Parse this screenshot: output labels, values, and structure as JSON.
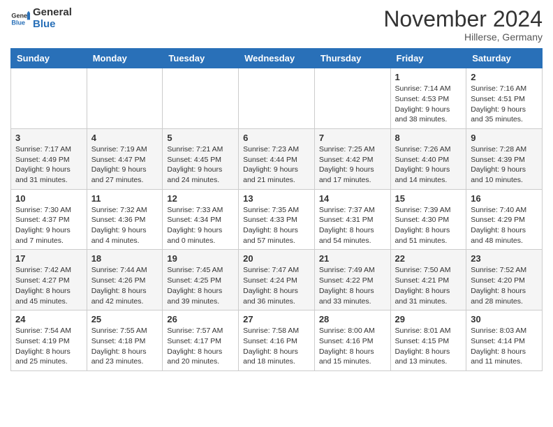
{
  "header": {
    "logo_general": "General",
    "logo_blue": "Blue",
    "title": "November 2024",
    "subtitle": "Hillerse, Germany"
  },
  "weekdays": [
    "Sunday",
    "Monday",
    "Tuesday",
    "Wednesday",
    "Thursday",
    "Friday",
    "Saturday"
  ],
  "weeks": [
    [
      {
        "day": "",
        "info": ""
      },
      {
        "day": "",
        "info": ""
      },
      {
        "day": "",
        "info": ""
      },
      {
        "day": "",
        "info": ""
      },
      {
        "day": "",
        "info": ""
      },
      {
        "day": "1",
        "info": "Sunrise: 7:14 AM\nSunset: 4:53 PM\nDaylight: 9 hours\nand 38 minutes."
      },
      {
        "day": "2",
        "info": "Sunrise: 7:16 AM\nSunset: 4:51 PM\nDaylight: 9 hours\nand 35 minutes."
      }
    ],
    [
      {
        "day": "3",
        "info": "Sunrise: 7:17 AM\nSunset: 4:49 PM\nDaylight: 9 hours\nand 31 minutes."
      },
      {
        "day": "4",
        "info": "Sunrise: 7:19 AM\nSunset: 4:47 PM\nDaylight: 9 hours\nand 27 minutes."
      },
      {
        "day": "5",
        "info": "Sunrise: 7:21 AM\nSunset: 4:45 PM\nDaylight: 9 hours\nand 24 minutes."
      },
      {
        "day": "6",
        "info": "Sunrise: 7:23 AM\nSunset: 4:44 PM\nDaylight: 9 hours\nand 21 minutes."
      },
      {
        "day": "7",
        "info": "Sunrise: 7:25 AM\nSunset: 4:42 PM\nDaylight: 9 hours\nand 17 minutes."
      },
      {
        "day": "8",
        "info": "Sunrise: 7:26 AM\nSunset: 4:40 PM\nDaylight: 9 hours\nand 14 minutes."
      },
      {
        "day": "9",
        "info": "Sunrise: 7:28 AM\nSunset: 4:39 PM\nDaylight: 9 hours\nand 10 minutes."
      }
    ],
    [
      {
        "day": "10",
        "info": "Sunrise: 7:30 AM\nSunset: 4:37 PM\nDaylight: 9 hours\nand 7 minutes."
      },
      {
        "day": "11",
        "info": "Sunrise: 7:32 AM\nSunset: 4:36 PM\nDaylight: 9 hours\nand 4 minutes."
      },
      {
        "day": "12",
        "info": "Sunrise: 7:33 AM\nSunset: 4:34 PM\nDaylight: 9 hours\nand 0 minutes."
      },
      {
        "day": "13",
        "info": "Sunrise: 7:35 AM\nSunset: 4:33 PM\nDaylight: 8 hours\nand 57 minutes."
      },
      {
        "day": "14",
        "info": "Sunrise: 7:37 AM\nSunset: 4:31 PM\nDaylight: 8 hours\nand 54 minutes."
      },
      {
        "day": "15",
        "info": "Sunrise: 7:39 AM\nSunset: 4:30 PM\nDaylight: 8 hours\nand 51 minutes."
      },
      {
        "day": "16",
        "info": "Sunrise: 7:40 AM\nSunset: 4:29 PM\nDaylight: 8 hours\nand 48 minutes."
      }
    ],
    [
      {
        "day": "17",
        "info": "Sunrise: 7:42 AM\nSunset: 4:27 PM\nDaylight: 8 hours\nand 45 minutes."
      },
      {
        "day": "18",
        "info": "Sunrise: 7:44 AM\nSunset: 4:26 PM\nDaylight: 8 hours\nand 42 minutes."
      },
      {
        "day": "19",
        "info": "Sunrise: 7:45 AM\nSunset: 4:25 PM\nDaylight: 8 hours\nand 39 minutes."
      },
      {
        "day": "20",
        "info": "Sunrise: 7:47 AM\nSunset: 4:24 PM\nDaylight: 8 hours\nand 36 minutes."
      },
      {
        "day": "21",
        "info": "Sunrise: 7:49 AM\nSunset: 4:22 PM\nDaylight: 8 hours\nand 33 minutes."
      },
      {
        "day": "22",
        "info": "Sunrise: 7:50 AM\nSunset: 4:21 PM\nDaylight: 8 hours\nand 31 minutes."
      },
      {
        "day": "23",
        "info": "Sunrise: 7:52 AM\nSunset: 4:20 PM\nDaylight: 8 hours\nand 28 minutes."
      }
    ],
    [
      {
        "day": "24",
        "info": "Sunrise: 7:54 AM\nSunset: 4:19 PM\nDaylight: 8 hours\nand 25 minutes."
      },
      {
        "day": "25",
        "info": "Sunrise: 7:55 AM\nSunset: 4:18 PM\nDaylight: 8 hours\nand 23 minutes."
      },
      {
        "day": "26",
        "info": "Sunrise: 7:57 AM\nSunset: 4:17 PM\nDaylight: 8 hours\nand 20 minutes."
      },
      {
        "day": "27",
        "info": "Sunrise: 7:58 AM\nSunset: 4:16 PM\nDaylight: 8 hours\nand 18 minutes."
      },
      {
        "day": "28",
        "info": "Sunrise: 8:00 AM\nSunset: 4:16 PM\nDaylight: 8 hours\nand 15 minutes."
      },
      {
        "day": "29",
        "info": "Sunrise: 8:01 AM\nSunset: 4:15 PM\nDaylight: 8 hours\nand 13 minutes."
      },
      {
        "day": "30",
        "info": "Sunrise: 8:03 AM\nSunset: 4:14 PM\nDaylight: 8 hours\nand 11 minutes."
      }
    ]
  ]
}
